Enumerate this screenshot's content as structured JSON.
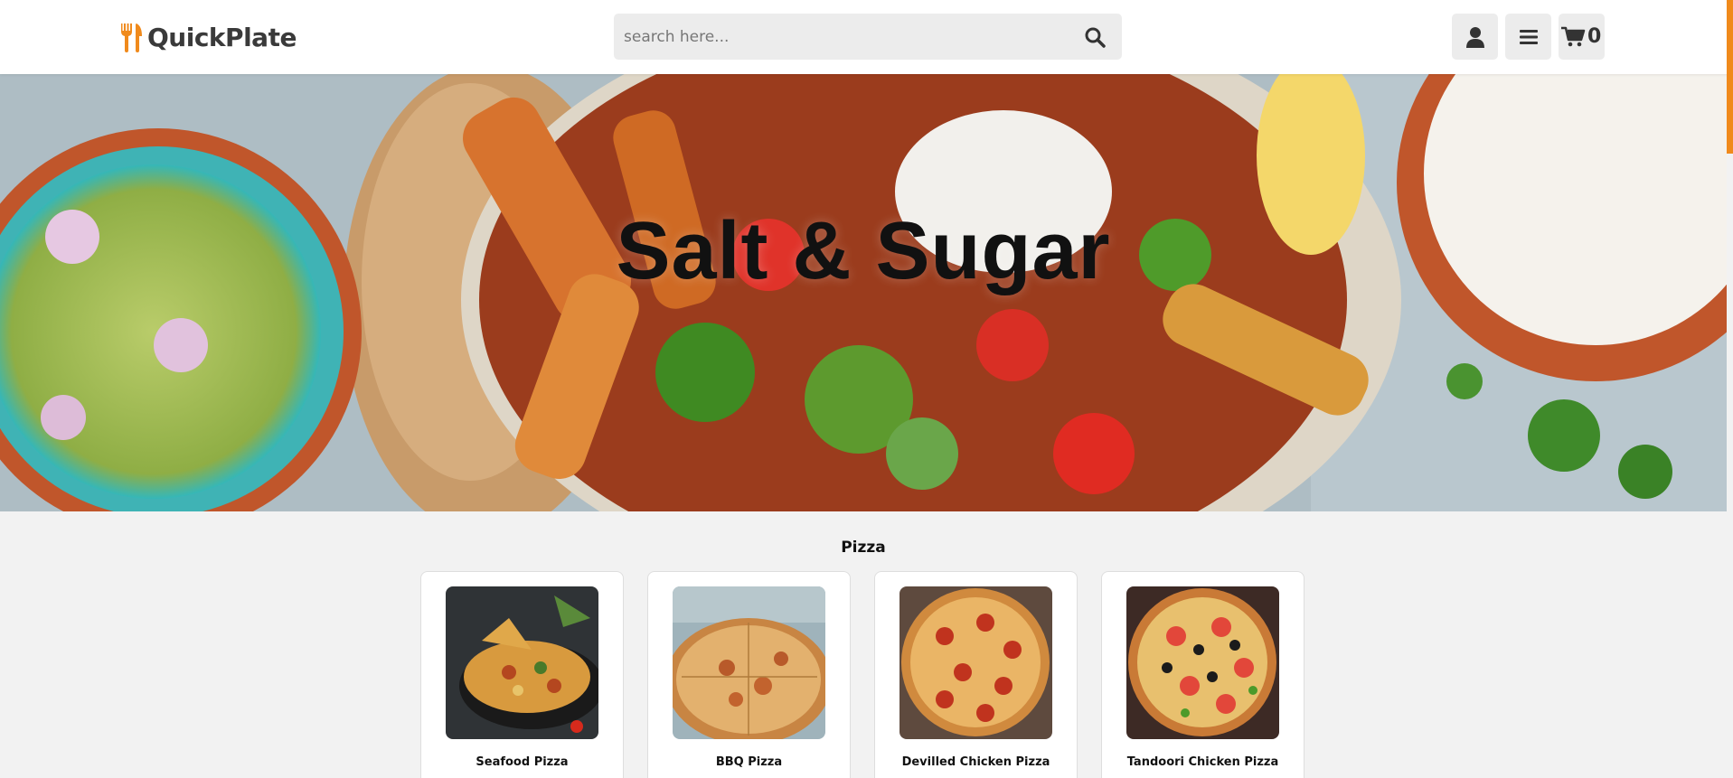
{
  "header": {
    "brand": "QuickPlate",
    "search_placeholder": "search here...",
    "cart_count": "0"
  },
  "hero": {
    "title": "Salt & Sugar"
  },
  "category": {
    "title": "Pizza",
    "items": [
      {
        "name": "Seafood Pizza"
      },
      {
        "name": "BBQ Pizza"
      },
      {
        "name": "Devilled Chicken Pizza"
      },
      {
        "name": "Tandoori Chicken Pizza"
      }
    ]
  },
  "icons": {
    "brand": "fork-knife-icon",
    "search": "search-icon",
    "user": "user-icon",
    "menu": "menu-icon",
    "cart": "cart-icon"
  },
  "colors": {
    "accent": "#f08a1c",
    "header_bg": "#ffffff",
    "page_bg": "#f2f2f2",
    "button_bg": "#ececec"
  }
}
